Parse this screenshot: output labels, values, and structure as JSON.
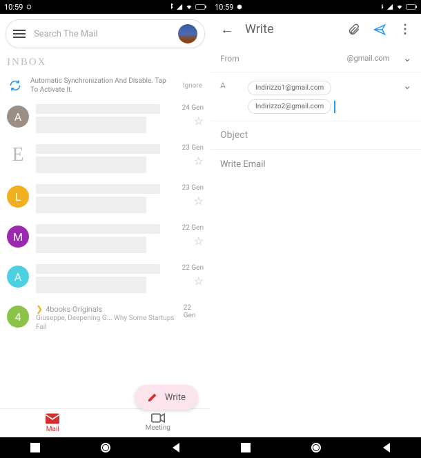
{
  "status": {
    "time": "10:59"
  },
  "left": {
    "search_placeholder": "Search The Mail",
    "inbox_label": "INBOX",
    "sync_text": "Automatic Synchronization And Disable. Tap To Activate It.",
    "ignore": "Ignore",
    "items": [
      {
        "avatar": "A",
        "color": "#9c8e82",
        "date": "24 Gen"
      },
      {
        "avatar": "E",
        "color": "letter",
        "date": "23 Gen"
      },
      {
        "avatar": "L",
        "color": "#f0b020",
        "date": "23 Gen"
      },
      {
        "avatar": "M",
        "color": "#9c27b0",
        "date": "22 Gen"
      },
      {
        "avatar": "A",
        "color": "#4dd0e1",
        "date": "22 Gen"
      },
      {
        "avatar": "4",
        "color": "#8bc34a",
        "date": "22 Gen",
        "title": "4books Originals",
        "sub": "Giuseppe, Deepening G...\nWhy Some Startups Fail"
      }
    ],
    "fab_label": "Write",
    "tabs": {
      "mail": "Mail",
      "meeting": "Meeting"
    }
  },
  "right": {
    "title": "Write",
    "from_label": "From",
    "from_value": "@gmail.com",
    "to_label": "A",
    "chips": [
      "Indirizzo1@gmail.com",
      "Indirizzo2@gmail.com"
    ],
    "subject_placeholder": "Object",
    "body_placeholder": "Write Email"
  }
}
